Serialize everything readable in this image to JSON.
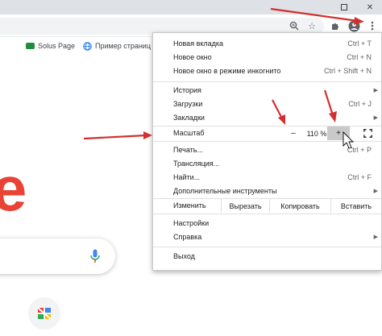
{
  "bookmarks": [
    {
      "label": "Solus Page",
      "icon": "solus-icon"
    },
    {
      "label": "Пример страниц",
      "icon": "globe-icon"
    }
  ],
  "menu": {
    "items_top": [
      {
        "label": "Новая вкладка",
        "shortcut": "Ctrl + T"
      },
      {
        "label": "Новое окно",
        "shortcut": "Ctrl + N"
      },
      {
        "label": "Новое окно в режиме инкогнито",
        "shortcut": "Ctrl + Shift + N"
      }
    ],
    "items_mid": [
      {
        "label": "История",
        "shortcut": "",
        "submenu": true
      },
      {
        "label": "Загрузки",
        "shortcut": "Ctrl + J",
        "submenu": false
      },
      {
        "label": "Закладки",
        "shortcut": "",
        "submenu": true
      }
    ],
    "zoom": {
      "label": "Масштаб",
      "minus": "–",
      "value": "110 %",
      "plus": "+"
    },
    "items_tools": [
      {
        "label": "Печать...",
        "shortcut": "Ctrl + P",
        "submenu": false
      },
      {
        "label": "Трансляция...",
        "shortcut": "",
        "submenu": false
      },
      {
        "label": "Найти...",
        "shortcut": "Ctrl + F",
        "submenu": false
      },
      {
        "label": "Дополнительные инструменты",
        "shortcut": "",
        "submenu": true
      }
    ],
    "edit": {
      "label": "Изменить",
      "cut": "Вырезать",
      "copy": "Копировать",
      "paste": "Вставить"
    },
    "items_settings": [
      {
        "label": "Настройки",
        "submenu": false
      },
      {
        "label": "Справка",
        "submenu": true
      }
    ],
    "exit": "Выход"
  },
  "colors": {
    "arrow": "#d32f2f",
    "accent": "#1a73e8",
    "google_red": "#ea4335"
  }
}
